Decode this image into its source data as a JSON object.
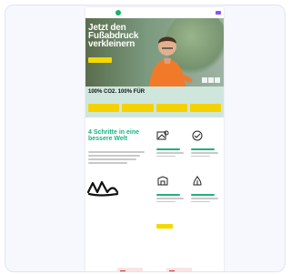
{
  "header": {
    "logo_text": "",
    "links": [
      "",
      "",
      ""
    ]
  },
  "hero": {
    "title": "Jetzt den Fußabdruck verkleinern",
    "cta_label": ""
  },
  "metrics": {
    "title": "100% CO2. 100% FÜR",
    "badges": [
      "",
      "",
      "",
      ""
    ]
  },
  "steps": {
    "title": "4 Schritte in eine bessere Welt",
    "cta_label": ""
  },
  "colors": {
    "green_brand": "#17b26a",
    "yellow_cta": "#f4d800",
    "mint_band": "#cfe6dc"
  }
}
